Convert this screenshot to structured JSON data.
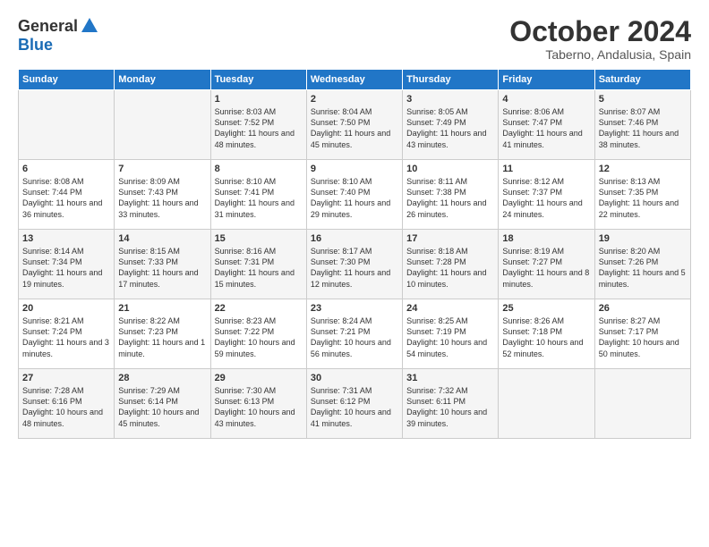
{
  "logo": {
    "general": "General",
    "blue": "Blue"
  },
  "title": "October 2024",
  "location": "Taberno, Andalusia, Spain",
  "weekdays": [
    "Sunday",
    "Monday",
    "Tuesday",
    "Wednesday",
    "Thursday",
    "Friday",
    "Saturday"
  ],
  "weeks": [
    [
      {
        "day": "",
        "content": ""
      },
      {
        "day": "",
        "content": ""
      },
      {
        "day": "1",
        "content": "Sunrise: 8:03 AM\nSunset: 7:52 PM\nDaylight: 11 hours and 48 minutes."
      },
      {
        "day": "2",
        "content": "Sunrise: 8:04 AM\nSunset: 7:50 PM\nDaylight: 11 hours and 45 minutes."
      },
      {
        "day": "3",
        "content": "Sunrise: 8:05 AM\nSunset: 7:49 PM\nDaylight: 11 hours and 43 minutes."
      },
      {
        "day": "4",
        "content": "Sunrise: 8:06 AM\nSunset: 7:47 PM\nDaylight: 11 hours and 41 minutes."
      },
      {
        "day": "5",
        "content": "Sunrise: 8:07 AM\nSunset: 7:46 PM\nDaylight: 11 hours and 38 minutes."
      }
    ],
    [
      {
        "day": "6",
        "content": "Sunrise: 8:08 AM\nSunset: 7:44 PM\nDaylight: 11 hours and 36 minutes."
      },
      {
        "day": "7",
        "content": "Sunrise: 8:09 AM\nSunset: 7:43 PM\nDaylight: 11 hours and 33 minutes."
      },
      {
        "day": "8",
        "content": "Sunrise: 8:10 AM\nSunset: 7:41 PM\nDaylight: 11 hours and 31 minutes."
      },
      {
        "day": "9",
        "content": "Sunrise: 8:10 AM\nSunset: 7:40 PM\nDaylight: 11 hours and 29 minutes."
      },
      {
        "day": "10",
        "content": "Sunrise: 8:11 AM\nSunset: 7:38 PM\nDaylight: 11 hours and 26 minutes."
      },
      {
        "day": "11",
        "content": "Sunrise: 8:12 AM\nSunset: 7:37 PM\nDaylight: 11 hours and 24 minutes."
      },
      {
        "day": "12",
        "content": "Sunrise: 8:13 AM\nSunset: 7:35 PM\nDaylight: 11 hours and 22 minutes."
      }
    ],
    [
      {
        "day": "13",
        "content": "Sunrise: 8:14 AM\nSunset: 7:34 PM\nDaylight: 11 hours and 19 minutes."
      },
      {
        "day": "14",
        "content": "Sunrise: 8:15 AM\nSunset: 7:33 PM\nDaylight: 11 hours and 17 minutes."
      },
      {
        "day": "15",
        "content": "Sunrise: 8:16 AM\nSunset: 7:31 PM\nDaylight: 11 hours and 15 minutes."
      },
      {
        "day": "16",
        "content": "Sunrise: 8:17 AM\nSunset: 7:30 PM\nDaylight: 11 hours and 12 minutes."
      },
      {
        "day": "17",
        "content": "Sunrise: 8:18 AM\nSunset: 7:28 PM\nDaylight: 11 hours and 10 minutes."
      },
      {
        "day": "18",
        "content": "Sunrise: 8:19 AM\nSunset: 7:27 PM\nDaylight: 11 hours and 8 minutes."
      },
      {
        "day": "19",
        "content": "Sunrise: 8:20 AM\nSunset: 7:26 PM\nDaylight: 11 hours and 5 minutes."
      }
    ],
    [
      {
        "day": "20",
        "content": "Sunrise: 8:21 AM\nSunset: 7:24 PM\nDaylight: 11 hours and 3 minutes."
      },
      {
        "day": "21",
        "content": "Sunrise: 8:22 AM\nSunset: 7:23 PM\nDaylight: 11 hours and 1 minute."
      },
      {
        "day": "22",
        "content": "Sunrise: 8:23 AM\nSunset: 7:22 PM\nDaylight: 10 hours and 59 minutes."
      },
      {
        "day": "23",
        "content": "Sunrise: 8:24 AM\nSunset: 7:21 PM\nDaylight: 10 hours and 56 minutes."
      },
      {
        "day": "24",
        "content": "Sunrise: 8:25 AM\nSunset: 7:19 PM\nDaylight: 10 hours and 54 minutes."
      },
      {
        "day": "25",
        "content": "Sunrise: 8:26 AM\nSunset: 7:18 PM\nDaylight: 10 hours and 52 minutes."
      },
      {
        "day": "26",
        "content": "Sunrise: 8:27 AM\nSunset: 7:17 PM\nDaylight: 10 hours and 50 minutes."
      }
    ],
    [
      {
        "day": "27",
        "content": "Sunrise: 7:28 AM\nSunset: 6:16 PM\nDaylight: 10 hours and 48 minutes."
      },
      {
        "day": "28",
        "content": "Sunrise: 7:29 AM\nSunset: 6:14 PM\nDaylight: 10 hours and 45 minutes."
      },
      {
        "day": "29",
        "content": "Sunrise: 7:30 AM\nSunset: 6:13 PM\nDaylight: 10 hours and 43 minutes."
      },
      {
        "day": "30",
        "content": "Sunrise: 7:31 AM\nSunset: 6:12 PM\nDaylight: 10 hours and 41 minutes."
      },
      {
        "day": "31",
        "content": "Sunrise: 7:32 AM\nSunset: 6:11 PM\nDaylight: 10 hours and 39 minutes."
      },
      {
        "day": "",
        "content": ""
      },
      {
        "day": "",
        "content": ""
      }
    ]
  ]
}
